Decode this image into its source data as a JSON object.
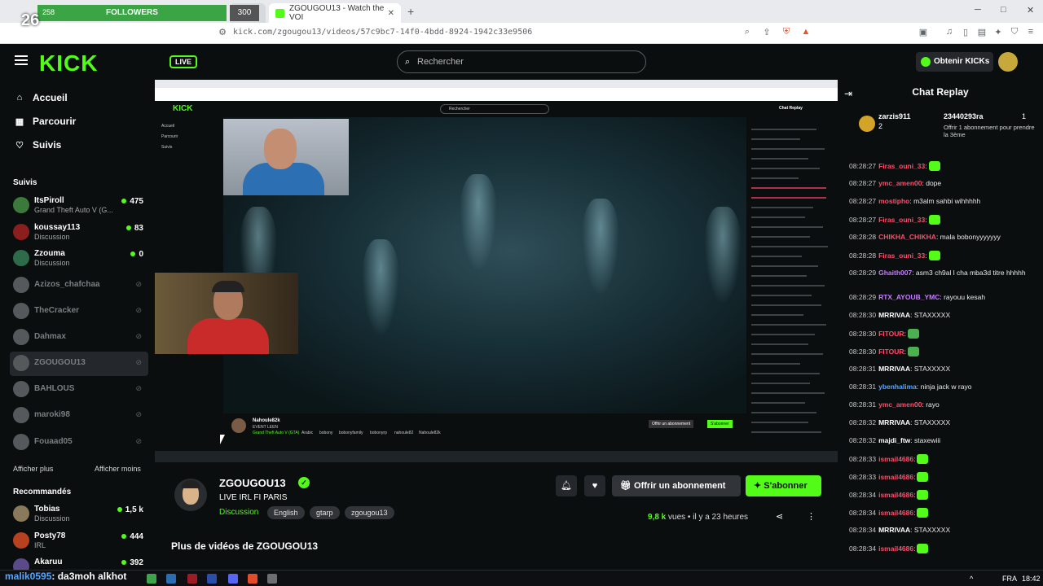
{
  "browser": {
    "active_tab": "ZGOUGOU13 - Watch the VOI",
    "url": "kick.com/zgougou13/videos/57c9bc7-14f0-4bdd-8924-1942c33e9506",
    "win_controls": [
      "─",
      "□",
      "✕"
    ]
  },
  "overlay": {
    "followers_label": "FOLLOWERS",
    "followers_left": "258",
    "followers_right": "300",
    "counter": "26",
    "live_badge": "LIVE"
  },
  "header": {
    "logo": "KICK",
    "search_placeholder": "Rechercher",
    "kicks_button": "Obtenir KICKs"
  },
  "sidebar": {
    "nav": [
      {
        "label": "Accueil",
        "icon": "home-icon"
      },
      {
        "label": "Parcourir",
        "icon": "browse-icon"
      },
      {
        "label": "Suivis",
        "icon": "heart-icon"
      }
    ],
    "followed_title": "Suivis",
    "followed": [
      {
        "name": "ItsPiroll",
        "sub": "Grand Theft Auto V (G...",
        "viewers": "475",
        "color": "#3b7a3b"
      },
      {
        "name": "koussay113",
        "sub": "Discussion",
        "viewers": "83",
        "color": "#8b1e1e"
      },
      {
        "name": "Zzouma",
        "sub": "Discussion",
        "viewers": "0",
        "color": "#2e6b4a"
      }
    ],
    "offline": [
      {
        "name": "Azizos_chafchaa",
        "active": false
      },
      {
        "name": "TheCracker",
        "active": false
      },
      {
        "name": "Dahmax",
        "active": false
      },
      {
        "name": "ZGOUGOU13",
        "active": true
      },
      {
        "name": "BAHLOUS",
        "active": false
      },
      {
        "name": "maroki98",
        "active": false
      },
      {
        "name": "Fouaad05",
        "active": false
      }
    ],
    "show_more": "Afficher plus",
    "show_less": "Afficher moins",
    "recommended_title": "Recommandés",
    "recommended": [
      {
        "name": "Tobias",
        "sub": "Discussion",
        "viewers": "1,5 k",
        "color": "#8a7a5c"
      },
      {
        "name": "Posty78",
        "sub": "IRL",
        "viewers": "444",
        "color": "#b8411f"
      },
      {
        "name": "Akaruu",
        "sub": "",
        "viewers": "392",
        "color": "#5b4a8a"
      }
    ]
  },
  "channel": {
    "name": "ZGOUGOU13",
    "title": "LIVE IRL FI PARIS",
    "category": "Discussion",
    "tags": [
      "English",
      "gtarp",
      "zgougou13"
    ],
    "gift_button": "Offrir un abonnement",
    "subscribe_button": "S'abonner",
    "views": "9,8 k",
    "views_suffix": "vues",
    "time_ago": "il y a 23 heures",
    "more_videos": "Plus de vidéos de ZGOUGOU13"
  },
  "video": {
    "inner_streamer": "Nahoule82k",
    "inner_event": "EVENT LEEN",
    "inner_category": "Grand Theft Auto V (GTA)",
    "inner_tags": [
      "Arabic",
      "bobony",
      "bobonyfamily",
      "bobonyrp",
      "nahoule82",
      "Nahoule82k"
    ],
    "inner_chat_title": "Chat Replay",
    "inner_search": "Rechercher",
    "inner_gift": "Offrir un abonnement",
    "inner_sub": "S'abonner",
    "inner_nav": [
      "Accueil",
      "Parcourir",
      "Suivis"
    ]
  },
  "chat": {
    "title": "Chat Replay",
    "pinned": {
      "user": "zarzis911",
      "count": "2",
      "user2": "23440293ra",
      "count2": "1",
      "message": "Offrir 1 abonnement pour prendre la 3ème"
    },
    "messages": [
      {
        "time": "08:28:27",
        "user": "Firas_ouni_33",
        "color": "#ff4d6a",
        "text": ":",
        "emote": "#53fc18"
      },
      {
        "time": "08:28:27",
        "user": "ymc_amen00",
        "color": "#ff4d6a",
        "text": ": dope",
        "emote": ""
      },
      {
        "time": "08:28:27",
        "user": "mostipho",
        "color": "#ff4d6a",
        "text": ": m3alm sahbi wihhhhh",
        "emote": ""
      },
      {
        "time": "08:28:27",
        "user": "Firas_ouni_33",
        "color": "#ff4d6a",
        "text": ":",
        "emote": "#53fc18"
      },
      {
        "time": "08:28:28",
        "user": "CHIKHA_CHIKHA",
        "color": "#ff4d6a",
        "text": ": mala bobonyyyyyyy",
        "emote": ""
      },
      {
        "time": "08:28:28",
        "user": "Firas_ouni_33",
        "color": "#ff4d6a",
        "text": ":",
        "emote": "#53fc18"
      },
      {
        "time": "08:28:29",
        "user": "Ghaith007",
        "color": "#c77dff",
        "text": ": asm3 ch9al l cha mba3d titre hhhhh",
        "emote": ""
      },
      {
        "time": "08:28:29",
        "user": "RTX_AYOUB_YMC",
        "color": "#c77dff",
        "text": ": rayouu kesah",
        "emote": ""
      },
      {
        "time": "08:28:30",
        "user": "MRRIVAA",
        "color": "#ffffff",
        "text": ": STAXXXXX",
        "emote": ""
      },
      {
        "time": "08:28:30",
        "user": "FITOUR",
        "color": "#ff4d6a",
        "text": ":",
        "emote": "#4caf50"
      },
      {
        "time": "08:28:30",
        "user": "FITOUR",
        "color": "#ff4d6a",
        "text": ":",
        "emote": "#4caf50"
      },
      {
        "time": "08:28:31",
        "user": "MRRIVAA",
        "color": "#ffffff",
        "text": ": STAXXXXX",
        "emote": ""
      },
      {
        "time": "08:28:31",
        "user": "ybenhalima",
        "color": "#58a6ff",
        "text": ": ninja jack w rayo",
        "emote": ""
      },
      {
        "time": "08:28:31",
        "user": "ymc_amen00",
        "color": "#ff4d6a",
        "text": ": rayo",
        "emote": ""
      },
      {
        "time": "08:28:32",
        "user": "MRRIVAA",
        "color": "#ffffff",
        "text": ": STAXXXXX",
        "emote": ""
      },
      {
        "time": "08:28:32",
        "user": "majdi_ftw",
        "color": "#ffffff",
        "text": ": staxewiii",
        "emote": ""
      },
      {
        "time": "08:28:33",
        "user": "ismail4686",
        "color": "#ff4d6a",
        "text": ":",
        "emote": "#53fc18"
      },
      {
        "time": "08:28:33",
        "user": "ismail4686",
        "color": "#ff4d6a",
        "text": ":",
        "emote": "#53fc18"
      },
      {
        "time": "08:28:34",
        "user": "ismail4686",
        "color": "#ff4d6a",
        "text": ":",
        "emote": "#53fc18"
      },
      {
        "time": "08:28:34",
        "user": "ismail4686",
        "color": "#ff4d6a",
        "text": ":",
        "emote": "#53fc18"
      },
      {
        "time": "08:28:34",
        "user": "MRRIVAA",
        "color": "#ffffff",
        "text": ": STAXXXXX",
        "emote": ""
      },
      {
        "time": "08:28:34",
        "user": "ismail4686",
        "color": "#ff4d6a",
        "text": ":",
        "emote": "#53fc18"
      }
    ]
  },
  "taskbar": {
    "alert_user": "malik0595",
    "alert_text": ": da3moh alkhot",
    "lang": "FRA",
    "clock": "18:42"
  }
}
